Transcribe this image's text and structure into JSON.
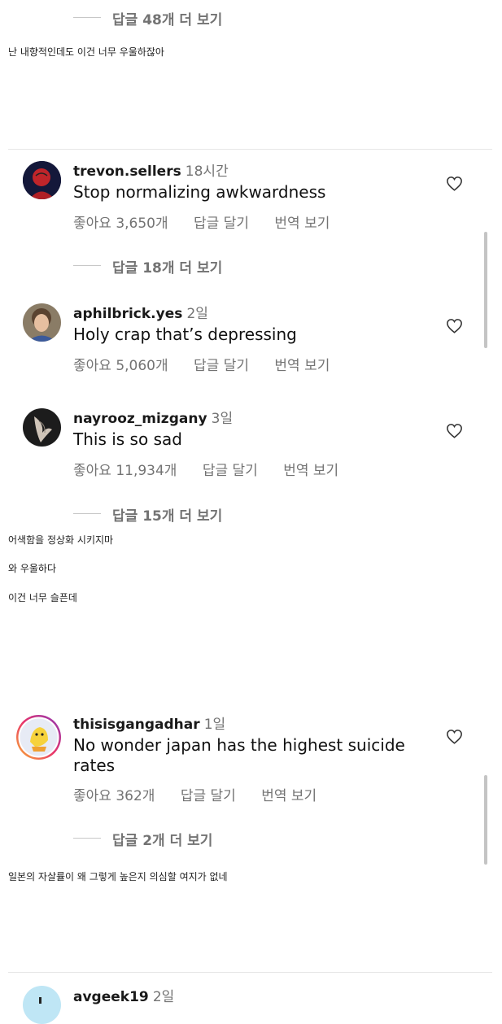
{
  "replies": {
    "r1": "답글 48개 더 보기",
    "r2": "답글 18개 더 보기",
    "r3": "답글 15개 더 보기",
    "r4": "답글 2개 더 보기"
  },
  "translations": {
    "t1": "난 내향적인데도 이건 너무 우울하잖아",
    "t2": "어색함을 정상화 시키지마",
    "t3": "와 우울하다",
    "t4": "이건 너무 슬픈데",
    "t5": "일본의 자살률이 왜 그렇게 높은지 의심할 여지가 없네"
  },
  "comments": [
    {
      "username": "trevon.sellers",
      "time": "18시간",
      "text": "Stop normalizing awkwardness",
      "likes": "좋아요 3,650개",
      "reply": "답글 달기",
      "translate": "번역 보기"
    },
    {
      "username": "aphilbrick.yes",
      "time": "2일",
      "text": "Holy crap that’s depressing",
      "likes": "좋아요 5,060개",
      "reply": "답글 달기",
      "translate": "번역 보기"
    },
    {
      "username": "nayrooz_mizgany",
      "time": "3일",
      "text": "This is so sad",
      "likes": "좋아요 11,934개",
      "reply": "답글 달기",
      "translate": "번역 보기"
    },
    {
      "username": "thisisgangadhar",
      "time": "1일",
      "text": "No wonder japan has the highest suicide rates",
      "likes": "좋아요 362개",
      "reply": "답글 달기",
      "translate": "번역 보기"
    },
    {
      "username": "avgeek19",
      "time": "2일"
    }
  ],
  "icons": {
    "heart": "heart-outline-icon"
  },
  "colors": {
    "secondary_text": "#737373",
    "divider": "#e6e6e6"
  }
}
